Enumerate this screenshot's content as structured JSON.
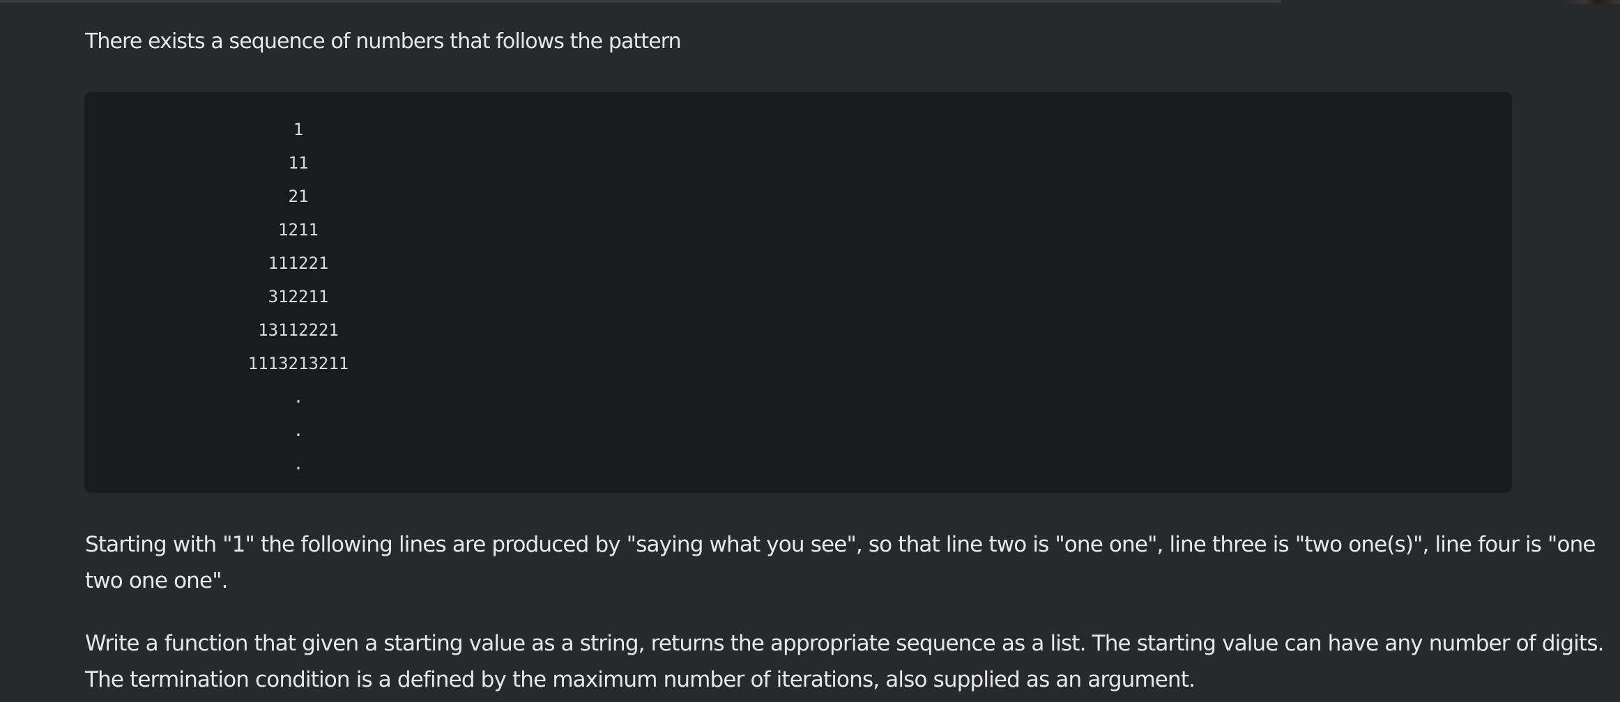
{
  "intro": "There exists a sequence of numbers that follows the pattern",
  "code_lines": [
    "1",
    "11",
    "21",
    "1211",
    "111221",
    "312211",
    "13112221",
    "1113213211",
    ".",
    ".",
    "."
  ],
  "paragraph1": {
    "line1": "Starting with \"1\" the following lines are produced by \"saying what you see\", so that line two is \"one one\", line three is \"two one(s)\", line four is \"one",
    "line2": "two one one\"."
  },
  "paragraph2": {
    "line1": "Write a function that given a starting value as a string, returns the appropriate sequence as a list. The starting value can have any number of digits.",
    "line2": "The termination condition is a defined by the maximum number of iterations, also supplied as an argument."
  }
}
